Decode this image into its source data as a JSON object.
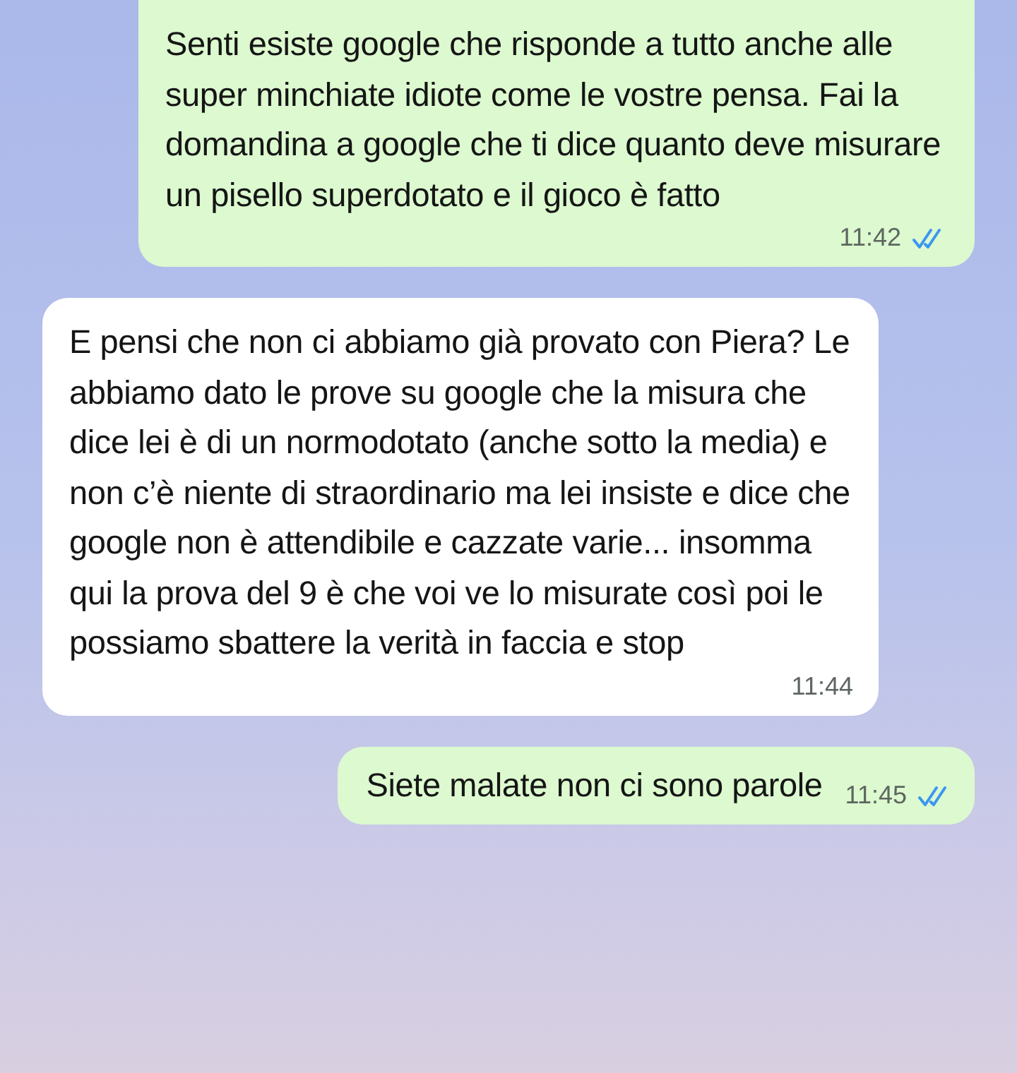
{
  "messages": [
    {
      "kind": "outgoing",
      "text": "Senti esiste google che risponde a tutto anche alle super minchiate idiote come le vostre pensa. Fai la domandina a google che ti dice quanto deve misurare un pisello superdotato e il gioco è fatto",
      "time": "11:42",
      "read": true
    },
    {
      "kind": "incoming",
      "text": "E pensi che non ci abbiamo già provato con Piera? Le abbiamo dato le prove su google che la misura che dice lei è di un normodotato (anche sotto la media) e non c’è niente di straordinario ma lei insiste e dice che google non è attendibile e cazzate varie... insomma qui la prova del 9 è che voi ve lo misurate così poi le possiamo sbattere la verità in faccia e stop",
      "time": "11:44"
    },
    {
      "kind": "outgoing",
      "text": "Siete malate non ci sono parole",
      "time": "11:45",
      "read": true
    }
  ]
}
